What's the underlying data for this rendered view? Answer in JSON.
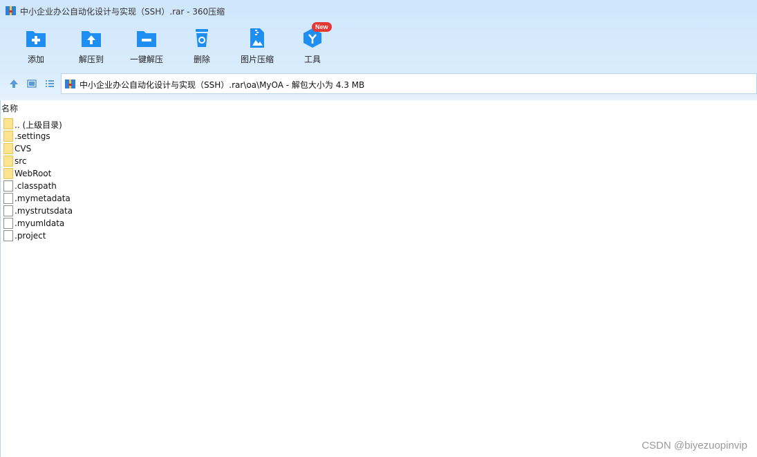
{
  "window": {
    "title": "中小企业办公自动化设计与实现（SSH）.rar - 360压缩"
  },
  "toolbar": {
    "buttons": [
      {
        "label": "添加",
        "icon": "add-folder-icon"
      },
      {
        "label": "解压到",
        "icon": "extract-to-icon"
      },
      {
        "label": "一键解压",
        "icon": "one-click-extract-icon"
      },
      {
        "label": "删除",
        "icon": "delete-trash-icon"
      },
      {
        "label": "图片压缩",
        "icon": "image-compress-icon"
      },
      {
        "label": "工具",
        "icon": "tools-cube-icon",
        "badge": "New"
      }
    ]
  },
  "navbar": {
    "path": "中小企业办公自动化设计与实现（SSH）.rar\\oa\\MyOA - 解包大小为 4.3 MB"
  },
  "list": {
    "column_name": "名称",
    "items": [
      {
        "name": ".. (上级目录)",
        "type": "folder"
      },
      {
        "name": ".settings",
        "type": "folder"
      },
      {
        "name": "CVS",
        "type": "folder"
      },
      {
        "name": "src",
        "type": "folder"
      },
      {
        "name": "WebRoot",
        "type": "folder"
      },
      {
        "name": ".classpath",
        "type": "file"
      },
      {
        "name": ".mymetadata",
        "type": "file"
      },
      {
        "name": ".mystrutsdata",
        "type": "file"
      },
      {
        "name": ".myumldata",
        "type": "file"
      },
      {
        "name": ".project",
        "type": "file"
      }
    ]
  },
  "watermark": "CSDN @biyezuopinvip",
  "colors": {
    "accent": "#1e8ff0",
    "header_bg": "#d6ebfc",
    "badge": "#e53935",
    "folder": "#fbe38f"
  }
}
